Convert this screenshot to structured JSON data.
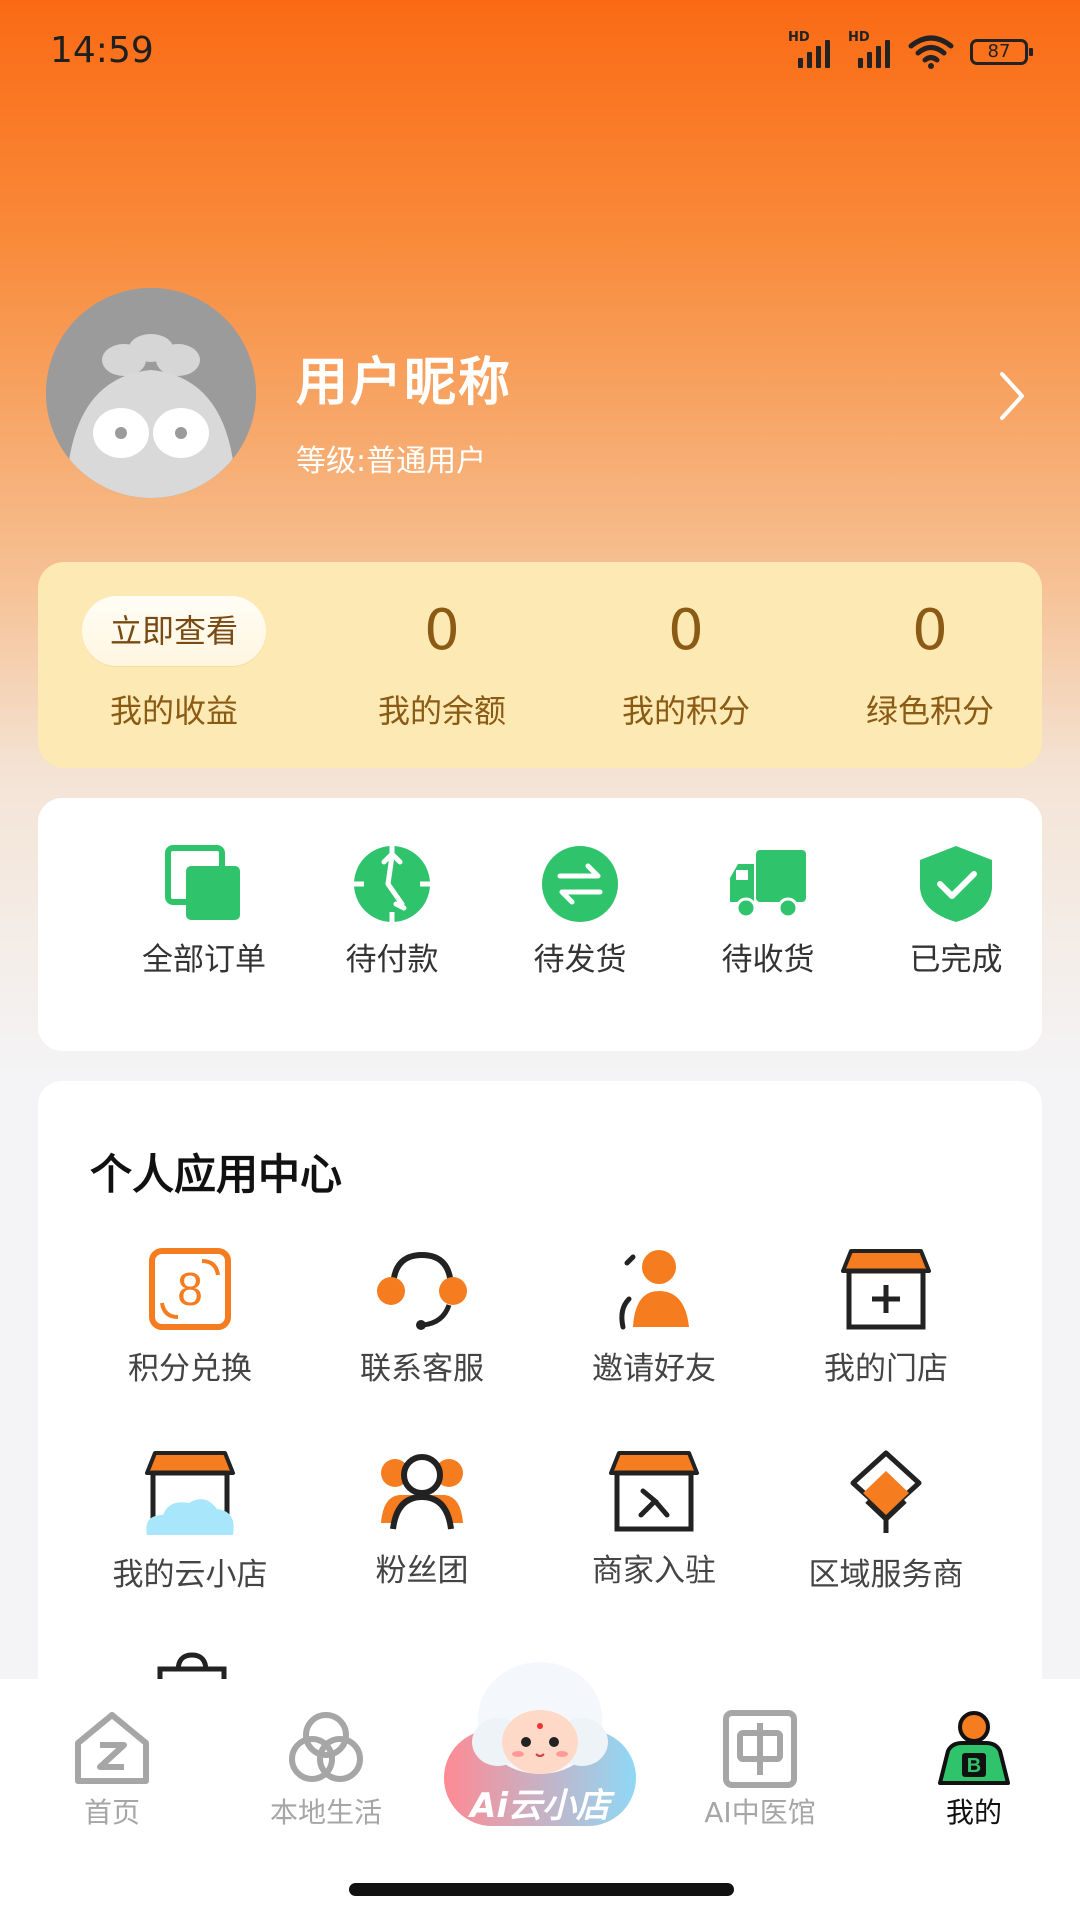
{
  "status_bar": {
    "time": "14:59",
    "signal1_label": "HD",
    "signal2_label": "HD",
    "battery": "87"
  },
  "profile": {
    "nickname": "用户昵称",
    "level": "等级:普通用户"
  },
  "earnings": {
    "view_button": "立即查看",
    "income_label": "我的收益",
    "balance_value": "0",
    "balance_label": "我的余额",
    "points_value": "0",
    "points_label": "我的积分",
    "green_value": "0",
    "green_label": "绿色积分"
  },
  "orders": [
    {
      "label": "全部订单",
      "icon": "all-orders-icon"
    },
    {
      "label": "待付款",
      "icon": "pending-payment-icon"
    },
    {
      "label": "待发货",
      "icon": "pending-shipment-icon"
    },
    {
      "label": "待收货",
      "icon": "truck-icon"
    },
    {
      "label": "已完成",
      "icon": "shield-check-icon"
    }
  ],
  "apps": {
    "title": "个人应用中心",
    "items": [
      {
        "label": "积分兑换",
        "icon": "points-exchange-icon"
      },
      {
        "label": "联系客服",
        "icon": "headset-icon"
      },
      {
        "label": "邀请好友",
        "icon": "invite-friend-icon"
      },
      {
        "label": "我的门店",
        "icon": "store-icon"
      },
      {
        "label": "我的云小店",
        "icon": "cloud-store-icon"
      },
      {
        "label": "粉丝团",
        "icon": "fans-icon"
      },
      {
        "label": "商家入驻",
        "icon": "merchant-join-icon"
      },
      {
        "label": "区域服务商",
        "icon": "region-provider-icon"
      }
    ]
  },
  "tabbar": {
    "home": "首页",
    "local": "本地生活",
    "ai_center_text": "Ai云小店",
    "medical": "AI中医馆",
    "mine": "我的"
  },
  "colors": {
    "accent_orange": "#fa6a14",
    "green": "#2fc46b",
    "earnings_bg": "#fde9b3",
    "earnings_text": "#8b5a14"
  }
}
